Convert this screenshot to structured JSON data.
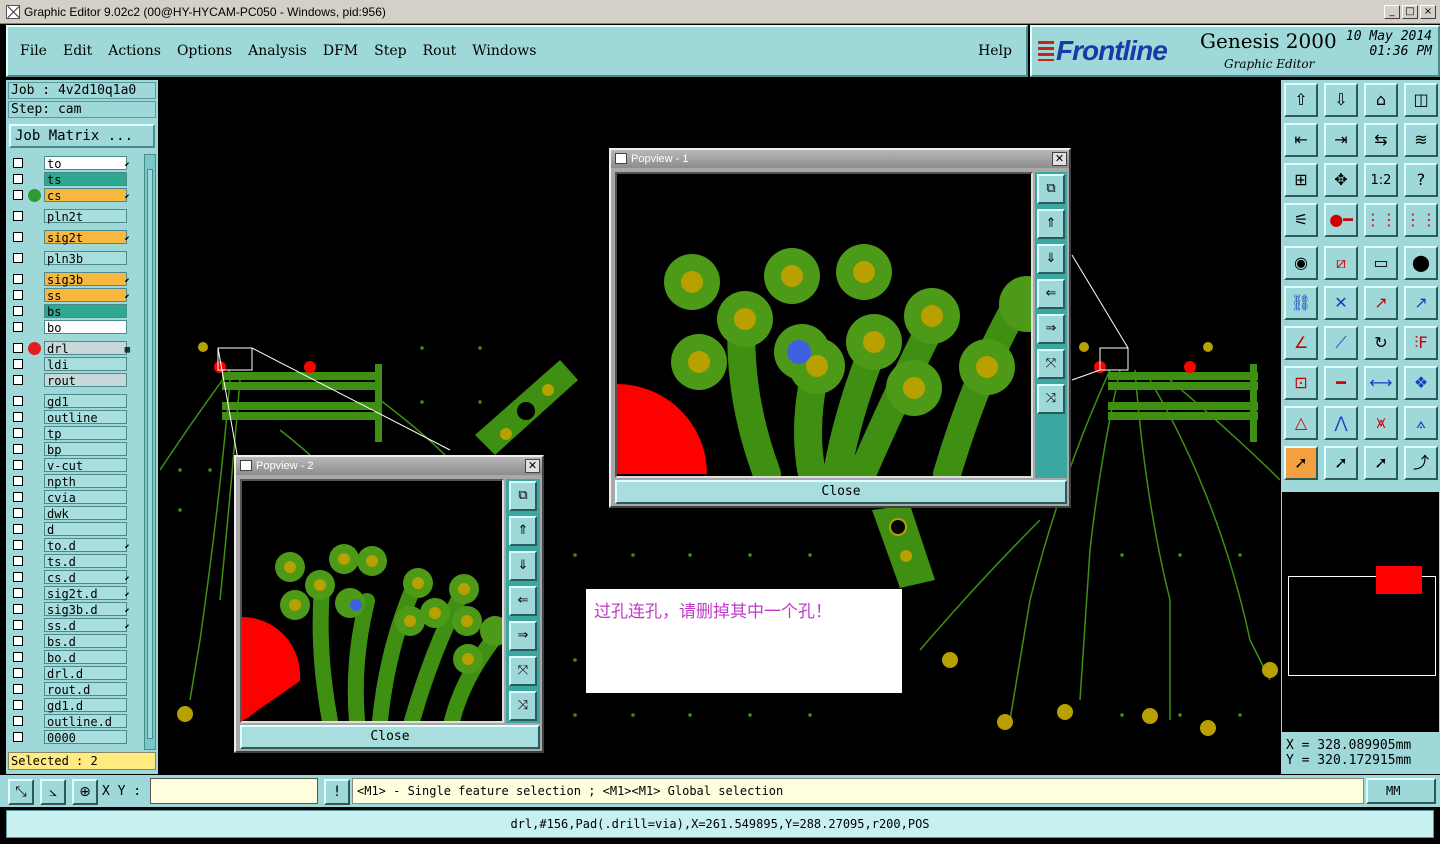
{
  "window": {
    "title": "Graphic Editor 9.02c2 (00@HY-HYCAM-PC050 - Windows, pid:956)",
    "controls": [
      "_",
      "□",
      "×"
    ]
  },
  "menu": {
    "items": [
      "File",
      "Edit",
      "Actions",
      "Options",
      "Analysis",
      "DFM",
      "Step",
      "Rout",
      "Windows"
    ],
    "help": "Help"
  },
  "brand": {
    "logo": "Frontline",
    "product": "Genesis 2000",
    "subtitle": "Graphic Editor",
    "date": "10 May 2014",
    "time": "01:36 PM"
  },
  "job": {
    "job_label": "Job : 4v2d10q1a0",
    "step_label": "Step: cam",
    "matrix_button": "Job Matrix ..."
  },
  "layers": [
    {
      "name": "to",
      "style": "white",
      "flag": "⬋"
    },
    {
      "name": "ts",
      "style": "teal"
    },
    {
      "name": "cs",
      "style": "orange",
      "flag": "⬋",
      "indicator": "#2e9a30"
    },
    {
      "name": "pln2t",
      "style": "plain"
    },
    {
      "name": "sig2t",
      "style": "orange",
      "flag": "⬋"
    },
    {
      "name": "pln3b",
      "style": "plain"
    },
    {
      "name": "sig3b",
      "style": "orange",
      "flag": "⬋"
    },
    {
      "name": "ss",
      "style": "orange",
      "flag": "⬋"
    },
    {
      "name": "bs",
      "style": "teal"
    },
    {
      "name": "bo",
      "style": "white"
    },
    {
      "name": "drl",
      "style": "gray",
      "flag": "▦",
      "indicator": "#e02020"
    },
    {
      "name": "ldi",
      "style": "plain"
    },
    {
      "name": "rout",
      "style": "gray"
    },
    {
      "name": "gd1",
      "style": "plain"
    },
    {
      "name": "outline",
      "style": "plain"
    },
    {
      "name": "tp",
      "style": "plain"
    },
    {
      "name": "bp",
      "style": "plain"
    },
    {
      "name": "v-cut",
      "style": "plain"
    },
    {
      "name": "npth",
      "style": "plain"
    },
    {
      "name": "cvia",
      "style": "plain"
    },
    {
      "name": "dwk",
      "style": "plain"
    },
    {
      "name": "d",
      "style": "plain"
    },
    {
      "name": "to.d",
      "style": "plain",
      "flag": "⬋"
    },
    {
      "name": "ts.d",
      "style": "plain"
    },
    {
      "name": "cs.d",
      "style": "plain",
      "flag": "⬋"
    },
    {
      "name": "sig2t.d",
      "style": "plain",
      "flag": "⬋"
    },
    {
      "name": "sig3b.d",
      "style": "plain",
      "flag": "⬋"
    },
    {
      "name": "ss.d",
      "style": "plain",
      "flag": "⬋"
    },
    {
      "name": "bs.d",
      "style": "plain"
    },
    {
      "name": "bo.d",
      "style": "plain"
    },
    {
      "name": "drl.d",
      "style": "plain"
    },
    {
      "name": "rout.d",
      "style": "plain"
    },
    {
      "name": "gd1.d",
      "style": "plain"
    },
    {
      "name": "outline.d",
      "style": "plain"
    },
    {
      "name": "0000",
      "style": "plain"
    }
  ],
  "selected": "Selected : 2",
  "popview1": {
    "title": "Popview - 1",
    "close": "Close"
  },
  "popview2": {
    "title": "Popview - 2",
    "close": "Close"
  },
  "note": "过孔连孔，请删掉其中一个孔！",
  "coords": {
    "x": "X = 328.089905mm",
    "y": "Y = 320.172915mm"
  },
  "cmd": {
    "xy_label": "X Y :",
    "xy_value": "",
    "hint": "<M1> - Single feature selection ; <M1><M1> Global selection",
    "units": "MM"
  },
  "status": "drl,#156,Pad(.drill=via),X=261.549895,Y=288.27095,r200,POS",
  "colors": {
    "panel": "#9fd8d8",
    "copper": "#3f8f12",
    "pad": "#b8a000",
    "hole": "#d4a020",
    "flash": "#ff0000",
    "selected_via": "#4060e0"
  }
}
